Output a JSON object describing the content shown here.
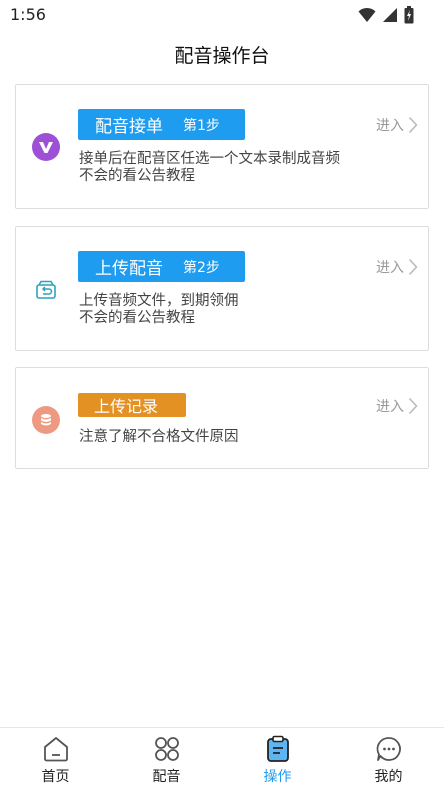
{
  "status_bar": {
    "time": "1:56"
  },
  "header": {
    "title": "配音操作台"
  },
  "cards": [
    {
      "icon": "v-logo-icon",
      "title": "配音接单",
      "step": "第1步",
      "enter_label": "进入",
      "desc_lines": [
        "接单后在配音区任选一个文本录制成音频",
        "不会的看公告教程"
      ]
    },
    {
      "icon": "upload-box-icon",
      "title": "上传配音",
      "step": "第2步",
      "enter_label": "进入",
      "desc_lines": [
        "上传音频文件，到期领佣",
        "不会的看公告教程"
      ]
    },
    {
      "icon": "database-icon",
      "title": "上传记录",
      "enter_label": "进入",
      "desc_lines": [
        "注意了解不合格文件原因"
      ]
    }
  ],
  "bottom_nav": [
    {
      "label": "首页",
      "icon": "home-icon"
    },
    {
      "label": "配音",
      "icon": "grid-icon"
    },
    {
      "label": "操作",
      "icon": "clipboard-icon",
      "active": true
    },
    {
      "label": "我的",
      "icon": "chat-icon"
    }
  ],
  "colors": {
    "badge_blue": "#1e9cf0",
    "badge_orange": "#e39123",
    "v_icon_bg": "#9d4fd6",
    "db_icon_bg": "#ee9a82",
    "nav_active": "#1e9cf0"
  }
}
